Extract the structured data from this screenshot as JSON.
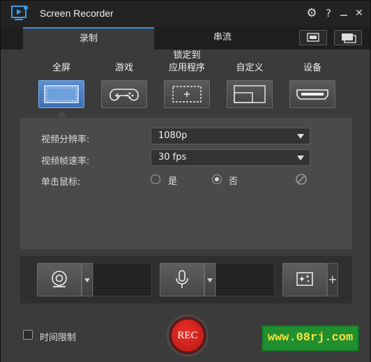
{
  "titlebar": {
    "title": "Screen Recorder",
    "settings_icon": "gear-icon",
    "help_label": "?",
    "minimize_icon": "minimize-icon",
    "close_label": "✕"
  },
  "tabs": [
    {
      "label": "录制",
      "active": true
    },
    {
      "label": "串流",
      "active": false
    }
  ],
  "modes": [
    {
      "label": "全屏",
      "icon": "fullscreen-icon",
      "selected": true
    },
    {
      "label": "游戏",
      "icon": "gamepad-icon",
      "selected": false
    },
    {
      "label": "锁定到",
      "label2": "应用程序",
      "icon": "lock-app-icon",
      "selected": false
    },
    {
      "label": "自定义",
      "icon": "custom-region-icon",
      "selected": false
    },
    {
      "label": "设备",
      "icon": "hdmi-device-icon",
      "selected": false
    }
  ],
  "settings": {
    "resolution_label": "视频分辨率:",
    "resolution_value": "1080p",
    "framerate_label": "视频帧速率:",
    "framerate_value": "30 fps",
    "click_label": "单击鼠标:",
    "click_yes": "是",
    "click_no": "否",
    "click_selected": "否"
  },
  "devices": {
    "webcam_icon": "webcam-icon",
    "mic_icon": "microphone-icon",
    "effects_icon": "sparkle-effects-icon",
    "add_label": "+"
  },
  "bottom": {
    "time_limit_label": "时间限制",
    "time_limit_checked": false,
    "rec_label": "REC"
  },
  "watermark": "www.08rj.com",
  "colors": {
    "accent": "#3a8ee6",
    "selected_mode": "#4a7fc4",
    "rec": "#d42a22",
    "watermark_bg": "#1f8f2f",
    "watermark_text": "#ffe23a"
  }
}
